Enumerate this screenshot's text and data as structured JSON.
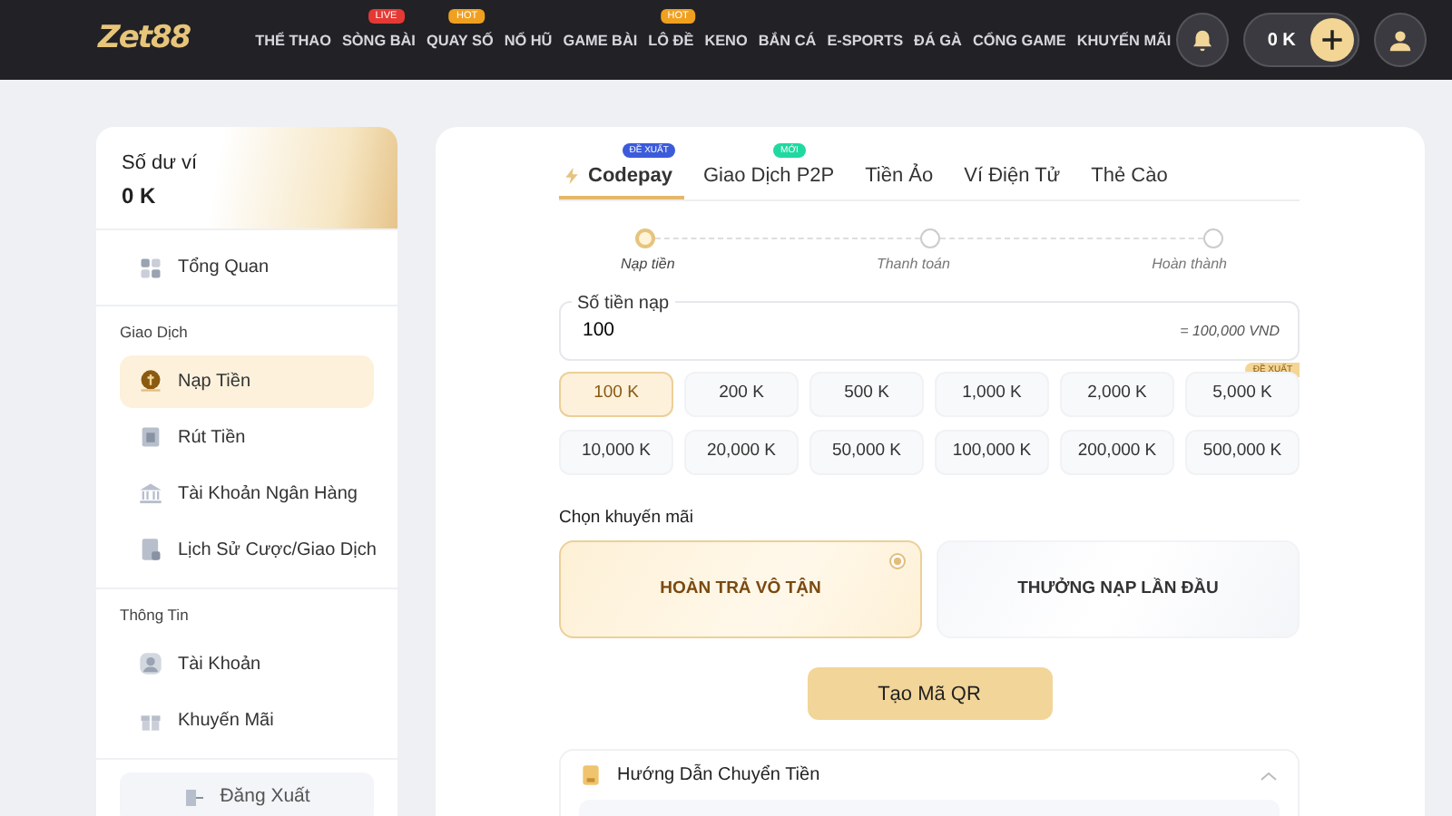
{
  "header": {
    "logo": "Zet88",
    "nav": [
      {
        "label": "THỂ THAO"
      },
      {
        "label": "SÒNG BÀI",
        "badge": {
          "text": "LIVE",
          "color": "#e53935"
        }
      },
      {
        "label": "QUAY SỐ",
        "badge": {
          "text": "HOT",
          "color": "#f0a020"
        }
      },
      {
        "label": "NỔ HŨ"
      },
      {
        "label": "GAME BÀI"
      },
      {
        "label": "LÔ ĐỀ",
        "badge": {
          "text": "HOT",
          "color": "#f0a020"
        }
      },
      {
        "label": "KENO"
      },
      {
        "label": "BẮN CÁ"
      },
      {
        "label": "E-SPORTS"
      },
      {
        "label": "ĐÁ GÀ"
      },
      {
        "label": "CỔNG GAME"
      },
      {
        "label": "KHUYẾN MÃI"
      }
    ],
    "balance": "0 K"
  },
  "sidebar": {
    "wallet_label": "Số dư ví",
    "wallet_value": "0 K",
    "sections": [
      {
        "items": [
          {
            "label": "Tổng Quan",
            "selected": false
          }
        ]
      },
      {
        "title": "Giao Dịch",
        "items": [
          {
            "label": "Nạp Tiền",
            "selected": true
          },
          {
            "label": "Rút Tiền",
            "selected": false
          },
          {
            "label": "Tài Khoản Ngân Hàng",
            "selected": false
          },
          {
            "label": "Lịch Sử Cược/Giao Dịch",
            "selected": false
          }
        ]
      },
      {
        "title": "Thông Tin",
        "items": [
          {
            "label": "Tài Khoản",
            "selected": false
          },
          {
            "label": "Khuyến Mãi",
            "selected": false
          }
        ]
      }
    ],
    "logout": "Đăng Xuất"
  },
  "tabs": [
    {
      "label": "Codepay",
      "selected": true,
      "badge": {
        "text": "ĐỀ XUẤT",
        "color": "#3b5bdb"
      }
    },
    {
      "label": "Giao Dịch P2P",
      "selected": false,
      "badge": {
        "text": "MỚI",
        "color": "#20d9a0"
      }
    },
    {
      "label": "Tiền Ảo",
      "selected": false
    },
    {
      "label": "Ví Điện Tử",
      "selected": false
    },
    {
      "label": "Thẻ Cào",
      "selected": false
    }
  ],
  "steps": [
    {
      "label": "Nạp tiền",
      "selected": true
    },
    {
      "label": "Thanh toán",
      "selected": false
    },
    {
      "label": "Hoàn thành",
      "selected": false
    }
  ],
  "amount_field": {
    "label": "Số tiền nạp",
    "value": "100",
    "converted": "= 100,000 VND"
  },
  "amounts": [
    {
      "label": "100 K",
      "selected": true
    },
    {
      "label": "200 K",
      "selected": false
    },
    {
      "label": "500 K",
      "selected": false
    },
    {
      "label": "1,000 K",
      "selected": false
    },
    {
      "label": "2,000 K",
      "selected": false
    },
    {
      "label": "5,000 K",
      "selected": false,
      "badge": "ĐỀ XUẤT"
    },
    {
      "label": "10,000 K",
      "selected": false
    },
    {
      "label": "20,000 K",
      "selected": false
    },
    {
      "label": "50,000 K",
      "selected": false
    },
    {
      "label": "100,000 K",
      "selected": false
    },
    {
      "label": "200,000 K",
      "selected": false
    },
    {
      "label": "500,000 K",
      "selected": false
    }
  ],
  "promo": {
    "title": "Chọn khuyến mãi",
    "options": [
      {
        "label": "HOÀN TRẢ VÔ TẬN",
        "selected": true
      },
      {
        "label": "THƯỞNG NẠP LẦN ĐẦU",
        "selected": false
      }
    ]
  },
  "submit": "Tạo Mã QR",
  "guide": {
    "title": "Hướng Dẫn Chuyển Tiền",
    "expanded": true
  }
}
